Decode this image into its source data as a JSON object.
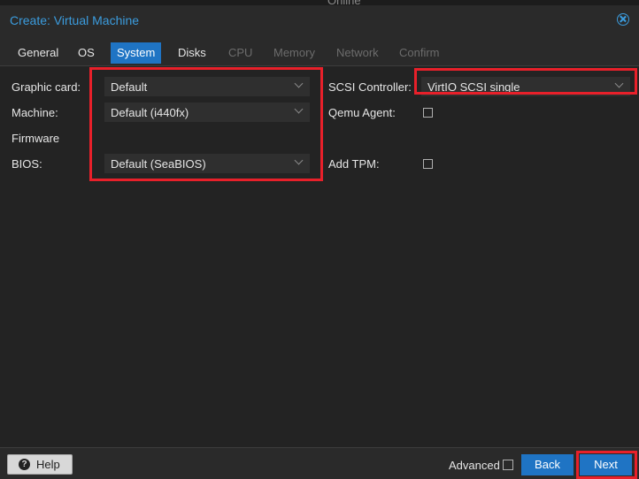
{
  "background": {
    "status_text": "Online"
  },
  "dialog": {
    "title": "Create: Virtual Machine"
  },
  "tabs": [
    {
      "label": "General",
      "state": "normal"
    },
    {
      "label": "OS",
      "state": "normal"
    },
    {
      "label": "System",
      "state": "active"
    },
    {
      "label": "Disks",
      "state": "normal"
    },
    {
      "label": "CPU",
      "state": "disabled"
    },
    {
      "label": "Memory",
      "state": "disabled"
    },
    {
      "label": "Network",
      "state": "disabled"
    },
    {
      "label": "Confirm",
      "state": "disabled"
    }
  ],
  "form": {
    "graphic_card": {
      "label": "Graphic card:",
      "value": "Default"
    },
    "machine": {
      "label": "Machine:",
      "value": "Default (i440fx)"
    },
    "firmware_section": "Firmware",
    "bios": {
      "label": "BIOS:",
      "value": "Default (SeaBIOS)"
    },
    "scsi_controller": {
      "label": "SCSI Controller:",
      "value": "VirtIO SCSI single"
    },
    "qemu_agent": {
      "label": "Qemu Agent:",
      "checked": false
    },
    "add_tpm": {
      "label": "Add TPM:",
      "checked": false
    }
  },
  "footer": {
    "help_label": "Help",
    "advanced_label": "Advanced",
    "advanced_checked": false,
    "back_label": "Back",
    "next_label": "Next"
  },
  "colors": {
    "accent": "#1f74c4",
    "title": "#3b9cde",
    "highlight": "#e8202a"
  },
  "icons": [
    "close-icon",
    "help-icon",
    "chevron-down-icon"
  ]
}
